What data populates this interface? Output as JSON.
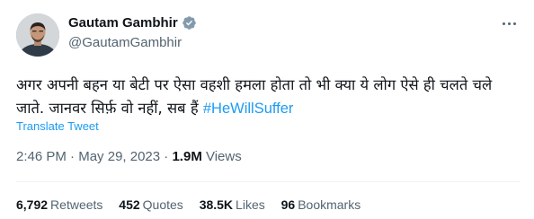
{
  "author": {
    "display_name": "Gautam Gambhir",
    "handle": "@GautamGambhir",
    "verified": true,
    "verified_color": "#829aab"
  },
  "tweet": {
    "text_main": "अगर अपनी बहन या बेटी पर ऐसा वहशी हमला होता तो भी क्या ये लोग ऐसे ही चलते चले जाते. जानवर सिर्फ़ वो नहीं, सब हैं ",
    "hashtag": "#HeWillSuffer",
    "translate_label": "Translate Tweet"
  },
  "meta": {
    "time": "2:46 PM",
    "separator": " · ",
    "date": "May 29, 2023",
    "views_count": "1.9M",
    "views_label": " Views"
  },
  "stats": [
    {
      "value": "6,792",
      "label": "Retweets"
    },
    {
      "value": "452",
      "label": "Quotes"
    },
    {
      "value": "38.5K",
      "label": "Likes"
    },
    {
      "value": "96",
      "label": "Bookmarks"
    }
  ],
  "colors": {
    "link": "#1d9bf0",
    "secondary_text": "#536471",
    "primary_text": "#0f1419"
  },
  "icons": {
    "verified": "verified-badge-icon",
    "more": "more-options-icon"
  }
}
